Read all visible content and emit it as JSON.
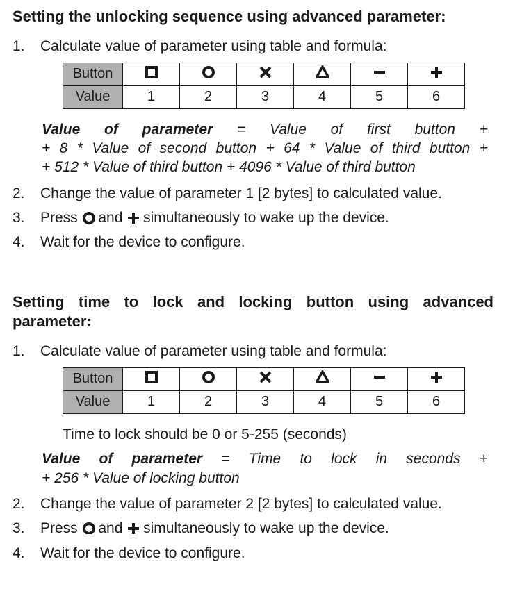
{
  "s1": {
    "heading": "Setting the unlocking sequence using advanced parameter:",
    "steps": {
      "s1": "Calculate value of parameter using table and formula:",
      "s2": "Change the value of parameter 1 [2 bytes] to calculated value.",
      "s3a": "Press ",
      "s3b": " and ",
      "s3c": " simultaneously to wake up the device.",
      "s4": "Wait for the device to configure."
    },
    "table": {
      "row1": {
        "h": "Button"
      },
      "row2": {
        "h": "Value",
        "c1": "1",
        "c2": "2",
        "c3": "3",
        "c4": "4",
        "c5": "5",
        "c6": "6"
      }
    },
    "formula": {
      "lead": "Value of parameter",
      "l1": " = Value of first button + ",
      "l2": "+ 8 * Value of second button +  64 * Value of third button + ",
      "l3": "+ 512 * Value of third button + 4096 * Value of third button"
    }
  },
  "s2": {
    "heading_l1": "Setting time to lock and locking button using advanced",
    "heading_l2": "parameter:",
    "steps": {
      "s1": "Calculate value of parameter using table and formula:",
      "s2": "Change the value of parameter 2 [2 bytes] to calculated value.",
      "s3a": "Press ",
      "s3b": " and ",
      "s3c": " simultaneously to wake up the device.",
      "s4": "Wait for the device to configure."
    },
    "table": {
      "row1": {
        "h": "Button"
      },
      "row2": {
        "h": "Value",
        "c1": "1",
        "c2": "2",
        "c3": "3",
        "c4": "4",
        "c5": "5",
        "c6": "6"
      }
    },
    "note": "Time to lock should be 0 or 5-255 (seconds)",
    "formula": {
      "lead": "Value of parameter",
      "l1": " = Time to lock in seconds + ",
      "l2": "+ 256 * Value of locking button"
    }
  },
  "icons": {
    "square": "square-icon",
    "circle": "circle-icon",
    "cross": "cross-icon",
    "triangle": "triangle-icon",
    "minus": "minus-icon",
    "plus": "plus-icon"
  }
}
